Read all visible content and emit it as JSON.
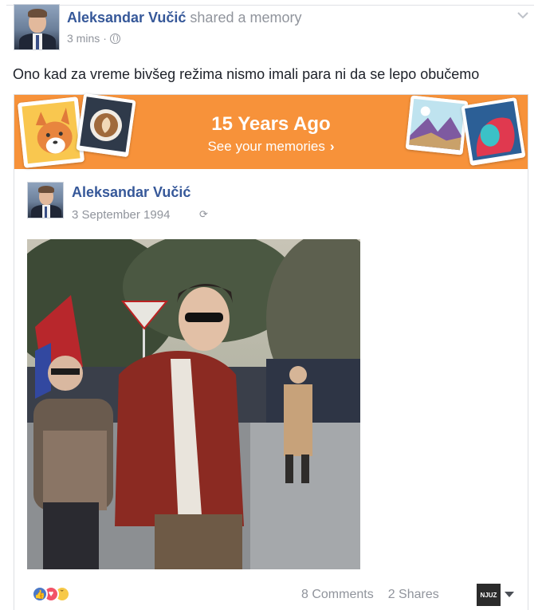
{
  "post": {
    "author_name": "Aleksandar Vučić",
    "action": "shared a memory",
    "time": "3 mins",
    "privacy_icon": "globe-icon",
    "status_text": "Ono kad za vreme bivšeg režima nismo imali para ni da se lepo obučemo"
  },
  "memory": {
    "banner_title": "15 Years Ago",
    "banner_link": "See your memories",
    "banner_color": "#f7923a",
    "original_author": "Aleksandar Vučić",
    "original_date": "3 September 1994"
  },
  "footer": {
    "comments": "8 Comments",
    "shares": "2 Shares",
    "share_avatar_label": "NJUZ",
    "reactions": [
      "like",
      "love",
      "sad"
    ]
  },
  "colors": {
    "link_blue": "#365899",
    "meta_gray": "#90949c"
  }
}
